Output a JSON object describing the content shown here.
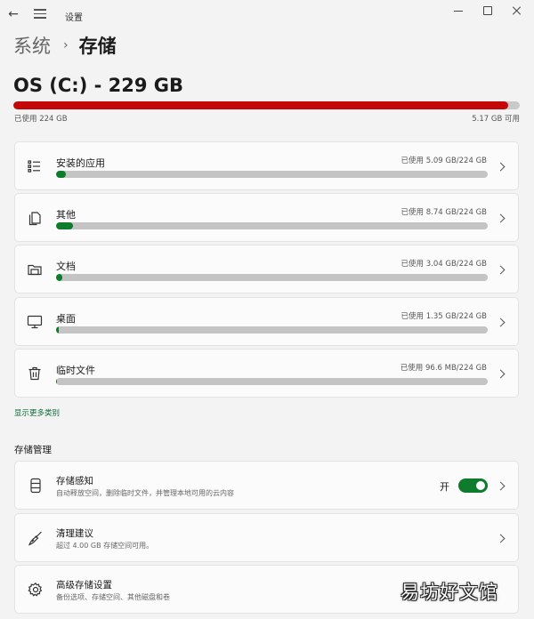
{
  "window": {
    "title": "设置"
  },
  "breadcrumb": {
    "parent": "系统",
    "separator": "›",
    "current": "存储"
  },
  "drive": {
    "title": "OS (C:) - 229 GB",
    "used_label": "已使用 224 GB",
    "free_label": "5.17 GB 可用",
    "used_fraction": 0.978,
    "bar_color": "#c40808"
  },
  "categories": [
    {
      "icon": "list-icon",
      "name": "安装的应用",
      "usage": "已使用 5.09 GB/224 GB",
      "fraction": 0.023
    },
    {
      "icon": "file-copy-icon",
      "name": "其他",
      "usage": "已使用 8.74 GB/224 GB",
      "fraction": 0.039
    },
    {
      "icon": "folder-icon",
      "name": "文档",
      "usage": "已使用 3.04 GB/224 GB",
      "fraction": 0.014
    },
    {
      "icon": "monitor-icon",
      "name": "桌面",
      "usage": "已使用 1.35 GB/224 GB",
      "fraction": 0.006
    },
    {
      "icon": "trash-icon",
      "name": "临时文件",
      "usage": "已使用 96.6 MB/224 GB",
      "fraction": 0.0004
    }
  ],
  "category_bar_color": "#0f7b2c",
  "show_more": "显示更多类别",
  "management": {
    "section_title": "存储管理",
    "items": [
      {
        "icon": "storage-sense-icon",
        "title": "存储感知",
        "desc": "自动释放空间，删除临时文件，并管理本地可用的云内容",
        "toggle_label": "开",
        "toggle_on": true
      },
      {
        "icon": "broom-icon",
        "title": "清理建议",
        "desc": "超过 4.00 GB 存储空间可用。"
      },
      {
        "icon": "gear-icon",
        "title": "高级存储设置",
        "desc": "备份选项、存储空间、其他磁盘和卷"
      }
    ]
  },
  "watermark": "易坊好文馆",
  "accent_color": "#0f7b2c"
}
